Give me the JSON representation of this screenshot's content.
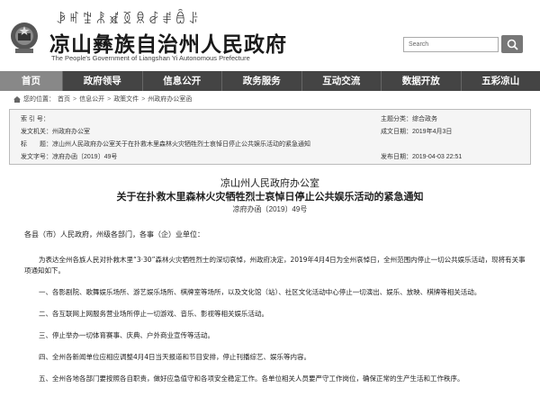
{
  "header": {
    "yi_script": "ꆃꎭꄹꂿꑵꅉꌋꆀꂱꎁꌠ",
    "site_title": "凉山彝族自治州人民政府",
    "site_subtitle": "The People's Government of Liangshan Yi Autonomous Prefecture",
    "search_placeholder": "Search"
  },
  "nav": {
    "items": [
      "首页",
      "政府领导",
      "信息公开",
      "政务服务",
      "互动交流",
      "数据开放",
      "五彩凉山"
    ]
  },
  "breadcrumb": {
    "prefix": "您的位置：",
    "items": [
      "首页",
      "信息公开",
      "政策文件",
      "州政府办公室函"
    ]
  },
  "info": {
    "index_label": "索 引 号：",
    "index_value": "",
    "topic_label": "主题分类：",
    "topic_value": "综合政务",
    "issuer_label": "发文机关：",
    "issuer_value": "州政府办公室",
    "date_label": "成文日期：",
    "date_value": "2019年4月3日",
    "title_label": "标　　题：",
    "title_value": "凉山州人民政府办公室关于在扑救木里森林火灾牺牲烈士哀悼日停止公共娱乐活动的紧急通知",
    "doc_no_label": "发文字号：",
    "doc_no_value": "凉府办函〔2019〕49号",
    "publish_label": "发布日期：",
    "publish_value": "2019-04-03 22:51"
  },
  "document": {
    "issuer": "凉山州人民政府办公室",
    "title": "关于在扑救木里森林火灾牺牲烈士哀悼日停止公共娱乐活动的紧急通知",
    "doc_number": "凉府办函〔2019〕49号",
    "salutation": "各县（市）人民政府，州级各部门，各事（企）业单位：",
    "intro": "为表达全州各族人民对扑救木里“3·30”森林火灾牺牲烈士的深切哀悼，州政府决定，2019年4月4日为全州哀悼日，全州范围内停止一切公共娱乐活动，现将有关事项通知如下。",
    "items": [
      "一、各影剧院、歌舞娱乐场所、游艺娱乐场所、棋牌室等场所，以及文化馆（站）、社区文化活动中心停止一切演出、娱乐、放映、棋牌等相关活动。",
      "二、各互联网上网服务营业场所停止一切游戏、音乐、影视等相关娱乐活动。",
      "三、停止举办一切体育赛事、庆典、户外商业宣传等活动。",
      "四、全州各新闻单位应相应调整4月4日当天报道和节目安排，停止刊播综艺、娱乐等内容。",
      "五、全州各地各部门要按照各自职责，做好应急值守和各项安全稳定工作。各单位相关人员要严守工作岗位，确保正常的生产生活和工作秩序。"
    ]
  }
}
